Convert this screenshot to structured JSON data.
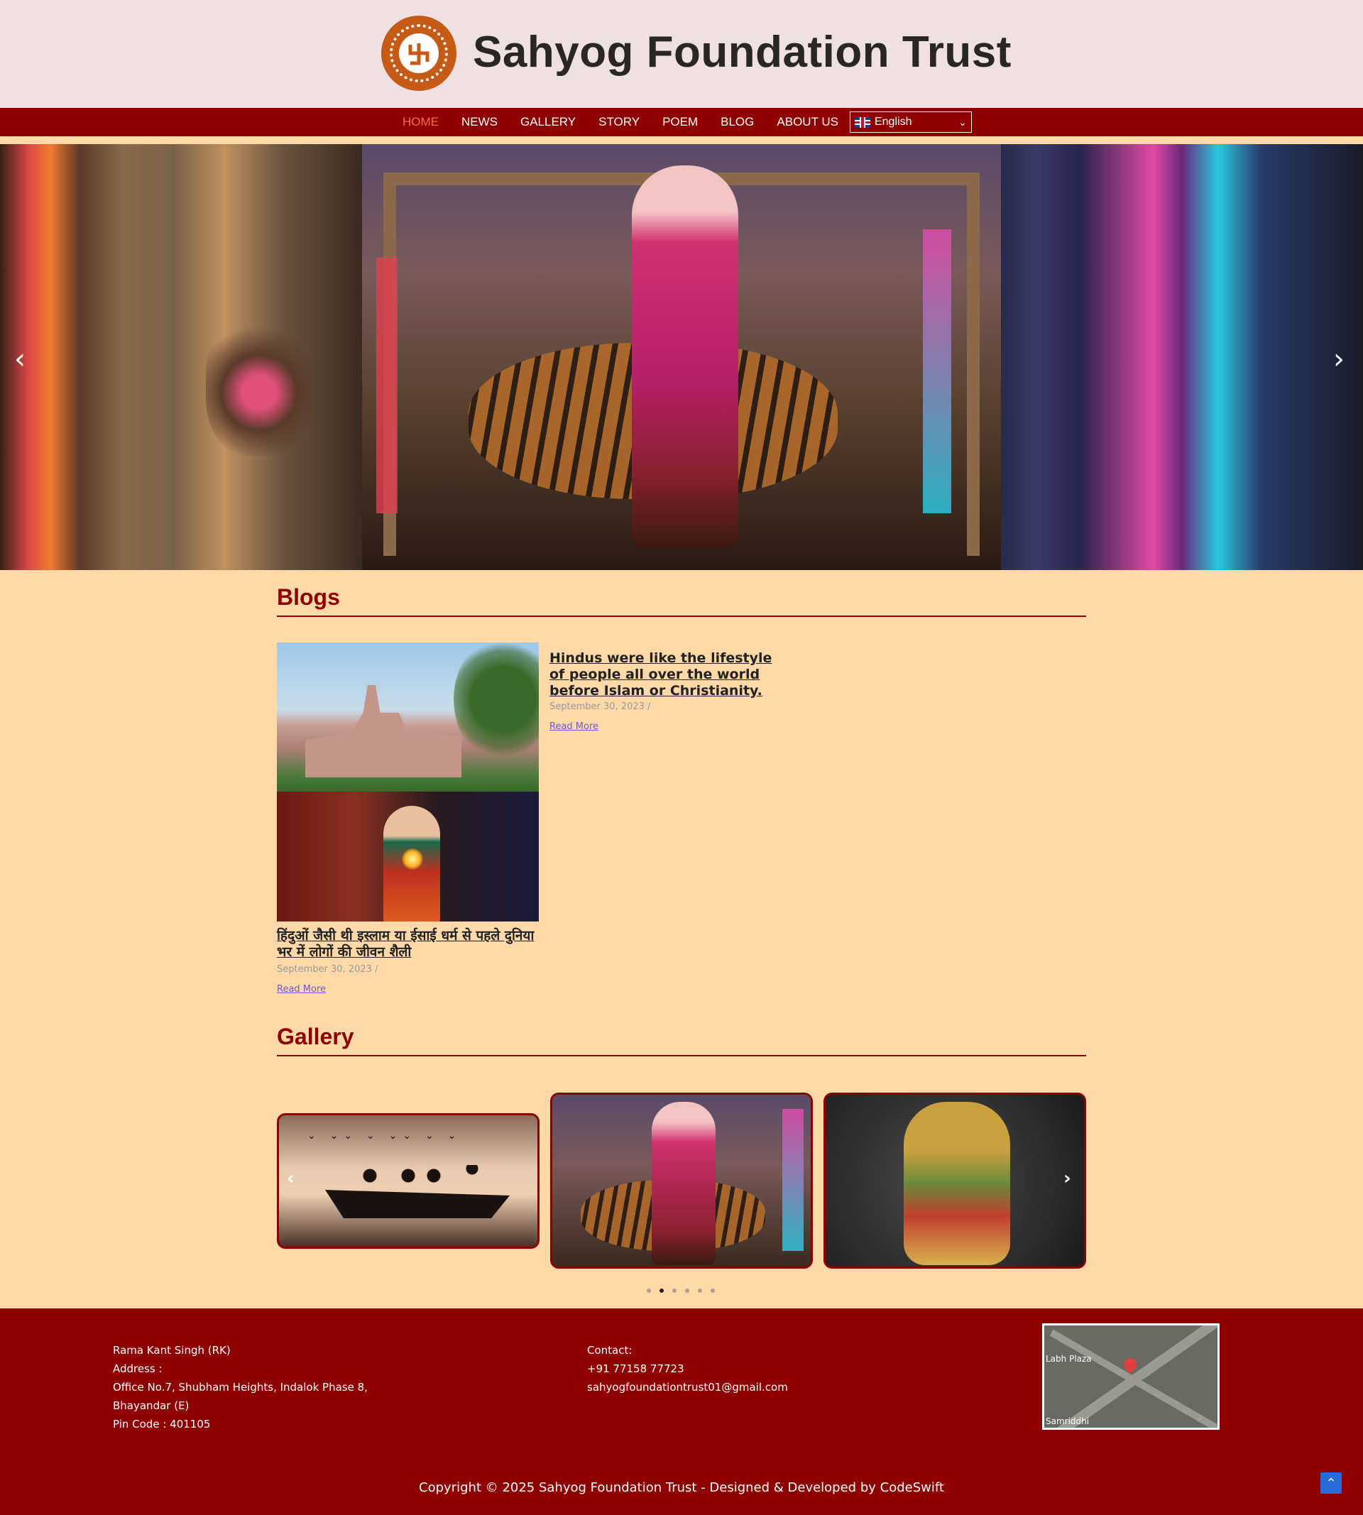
{
  "site": {
    "title": "Sahyog Foundation Trust"
  },
  "nav": {
    "items": [
      {
        "label": "HOME",
        "active": true
      },
      {
        "label": "NEWS"
      },
      {
        "label": "GALLERY"
      },
      {
        "label": "STORY"
      },
      {
        "label": "POEM"
      },
      {
        "label": "BLOG"
      },
      {
        "label": "ABOUT US"
      }
    ],
    "language": "English"
  },
  "hero": {
    "prev": "‹",
    "next": "›"
  },
  "blogs": {
    "heading": "Blogs",
    "posts": [
      {
        "title": "Hindus were like the lifestyle of people all over the world before Islam or Christianity.",
        "date": "September 30, 2023 /",
        "read_more": "Read More"
      },
      {
        "title": "हिंदुओं जैसी थी इस्लाम या ईसाई धर्म से पहले दुनिया भर में लोगों की जीवन शैली",
        "date": "September 30, 2023 /",
        "read_more": "Read More"
      }
    ]
  },
  "gallery": {
    "heading": "Gallery",
    "prev": "‹",
    "next": "›",
    "active_page": 2,
    "page_count": 6
  },
  "footer": {
    "address": [
      "Rama Kant Singh (RK)",
      "Address :",
      "Office No.7, Shubham Heights, Indalok Phase 8,",
      "Bhayandar (E)",
      "Pin Code : 401105"
    ],
    "contact": [
      "Contact:",
      "+91 77158 77723",
      "sahyogfoundationtrust01@gmail.com"
    ],
    "map_labels": [
      "Labh Plaza",
      "Samriddhi"
    ],
    "copyright": "Copyright © 2025 Sahyog Foundation Trust - Designed & Developed by CodeSwift",
    "to_top": "⌃"
  },
  "colors": {
    "brand": "#8e0000",
    "page_bg": "#ffdaa8",
    "header_bg": "#efe1e1",
    "nav_active": "#ff6a4d"
  }
}
